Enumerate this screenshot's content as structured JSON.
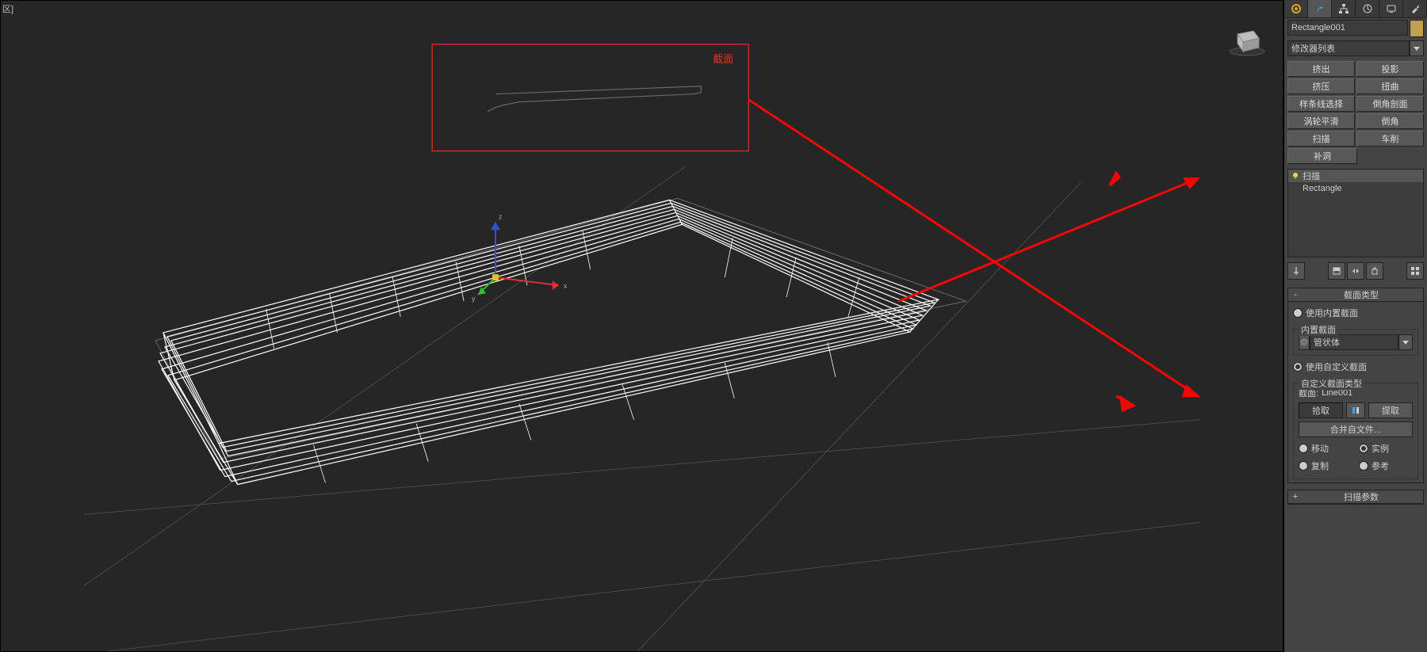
{
  "viewport": {
    "label": "区]",
    "annotation_label": "截面"
  },
  "panel": {
    "object_name": "Rectangle001",
    "modifier_list_label": "修改器列表",
    "buttons": {
      "extrude": "挤出",
      "project": "投影",
      "squeeze": "挤压",
      "twist": "扭曲",
      "spline_select": "样条线选择",
      "chamfer_section": "倒角剖面",
      "turbo_smooth": "涡轮平滑",
      "chamfer": "倒角",
      "sweep": "扫描",
      "lathe": "车削",
      "cap_holes": "补洞"
    },
    "stack": {
      "item_sweep": "扫描",
      "item_rectangle": "Rectangle"
    },
    "rollout_section_type": {
      "title": "截面类型",
      "use_builtin": "使用内置截面",
      "builtin_group": "内置截面",
      "builtin_value": "管状体",
      "use_custom": "使用自定义截面",
      "custom_group": "自定义截面类型",
      "section_label": "截面:",
      "section_value": "Line001",
      "pick": "拾取",
      "extract": "提取",
      "merge_from_file": "合并自文件...",
      "move": "移动",
      "instance": "实例",
      "copy": "复制",
      "reference": "参考"
    },
    "rollout_sweep_params": {
      "title": "扫描参数"
    }
  }
}
